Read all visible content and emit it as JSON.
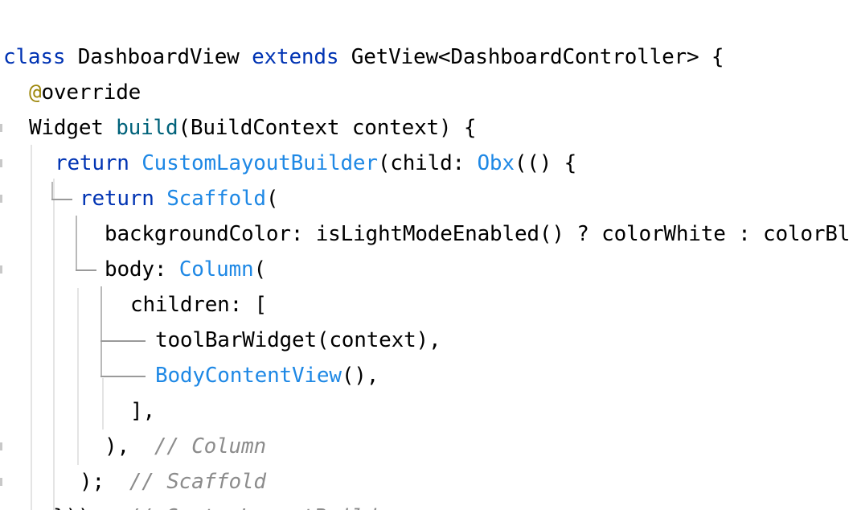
{
  "code": {
    "lines": [
      {
        "segments": [
          {
            "text": "class",
            "type": "kw"
          },
          {
            "text": " DashboardView ",
            "type": "plain"
          },
          {
            "text": "extends",
            "type": "kw"
          },
          {
            "text": " GetView<DashboardController> {",
            "type": "plain"
          }
        ]
      },
      {
        "segments": [
          {
            "text": "@",
            "type": "ann"
          },
          {
            "text": "override",
            "type": "plain"
          }
        ]
      },
      {
        "segments": [
          {
            "text": "Widget ",
            "type": "plain"
          },
          {
            "text": "build",
            "type": "fn"
          },
          {
            "text": "(BuildContext context) {",
            "type": "plain"
          }
        ]
      },
      {
        "segments": [
          {
            "text": "return ",
            "type": "kw"
          },
          {
            "text": "CustomLayoutBuilder",
            "type": "ty"
          },
          {
            "text": "(child: ",
            "type": "plain"
          },
          {
            "text": "Obx",
            "type": "ty"
          },
          {
            "text": "(() {",
            "type": "plain"
          }
        ]
      },
      {
        "segments": [
          {
            "text": "return ",
            "type": "kw"
          },
          {
            "text": "Scaffold",
            "type": "ty"
          },
          {
            "text": "(",
            "type": "plain"
          }
        ]
      },
      {
        "segments": [
          {
            "text": "backgroundColor: isLightModeEnabled() ? colorWhite : colorBl",
            "type": "plain"
          }
        ]
      },
      {
        "segments": [
          {
            "text": "body: ",
            "type": "plain"
          },
          {
            "text": "Column",
            "type": "ty"
          },
          {
            "text": "(",
            "type": "plain"
          }
        ]
      },
      {
        "segments": [
          {
            "text": "children: [",
            "type": "plain"
          }
        ]
      },
      {
        "segments": [
          {
            "text": "toolBarWidget(context),",
            "type": "plain"
          }
        ]
      },
      {
        "segments": [
          {
            "text": "BodyContentView",
            "type": "ty"
          },
          {
            "text": "(),",
            "type": "plain"
          }
        ]
      },
      {
        "segments": [
          {
            "text": "],",
            "type": "plain"
          }
        ]
      },
      {
        "segments": [
          {
            "text": "), ",
            "type": "plain"
          },
          {
            "text": " // Column",
            "type": "cm"
          }
        ]
      },
      {
        "segments": [
          {
            "text": "); ",
            "type": "plain"
          },
          {
            "text": " // Scaffold",
            "type": "cm"
          }
        ]
      },
      {
        "segments": [
          {
            "text": "})); ",
            "type": "plain"
          },
          {
            "text": " // CustomLayoutBuilder",
            "type": "cm"
          }
        ]
      }
    ]
  },
  "colors": {
    "keyword": "#0033b3",
    "function": "#00627a",
    "type": "#1e88e5",
    "annotation": "#9e880d",
    "comment": "#8c8c8c",
    "text": "#000000",
    "background": "#ffffff"
  }
}
